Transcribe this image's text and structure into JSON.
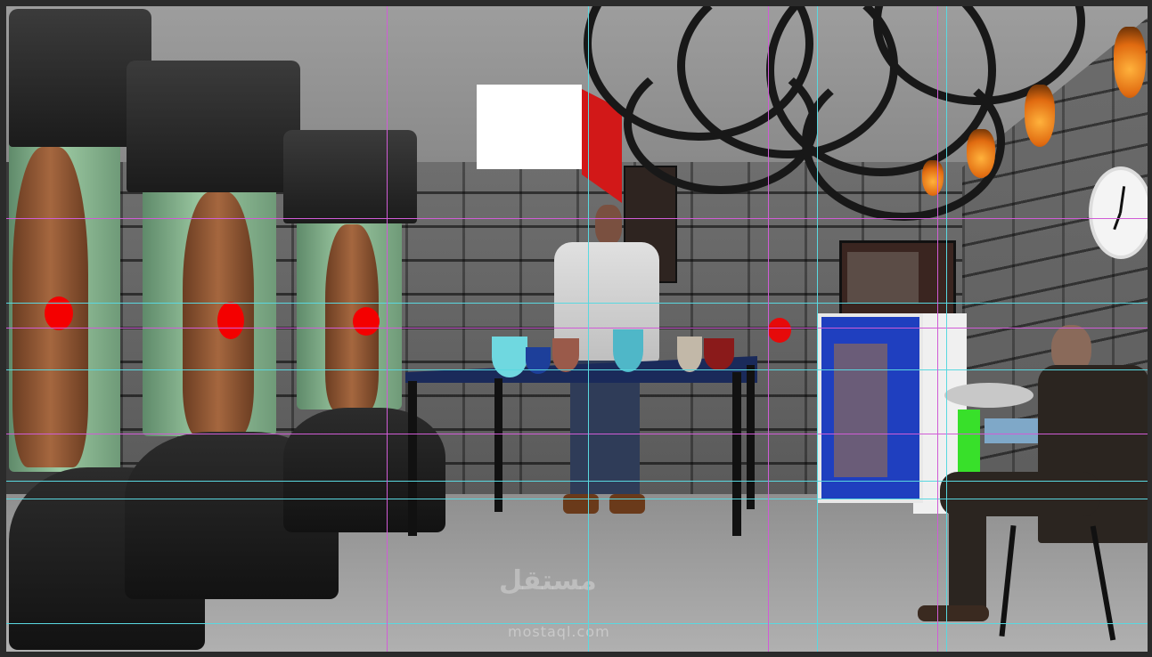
{
  "scene": {
    "watermark_text": "mostaql.com",
    "watermark_arabic": "مستقل",
    "colors": {
      "guide_cyan": "#59d8e0",
      "guide_magenta": "#d05cd6",
      "censor_red": "#f40000",
      "fridge_blue": "#1f3fbf",
      "table_blue": "#1a2a5a"
    },
    "icons": [
      "clock-icon",
      "torch-icon",
      "chandelier-icon",
      "tv-icon",
      "fridge-icon"
    ]
  }
}
